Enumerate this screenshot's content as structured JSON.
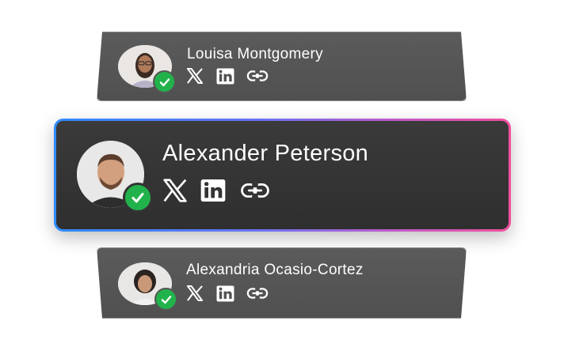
{
  "profiles": [
    {
      "name": "Louisa Montgomery",
      "verified": true,
      "links": [
        "x-icon",
        "linkedin-icon",
        "link-icon"
      ]
    },
    {
      "name": "Alexander Peterson",
      "verified": true,
      "links": [
        "x-icon",
        "linkedin-icon",
        "link-icon"
      ]
    },
    {
      "name": "Alexandria Ocasio-Cortez",
      "verified": true,
      "links": [
        "x-icon",
        "linkedin-icon",
        "link-icon"
      ]
    }
  ],
  "colors": {
    "verified_badge": "#22b24c",
    "highlight_gradient": [
      "#2f8cff",
      "#c25ac8",
      "#f2509e"
    ],
    "card_bg": "#3a3a3a"
  }
}
